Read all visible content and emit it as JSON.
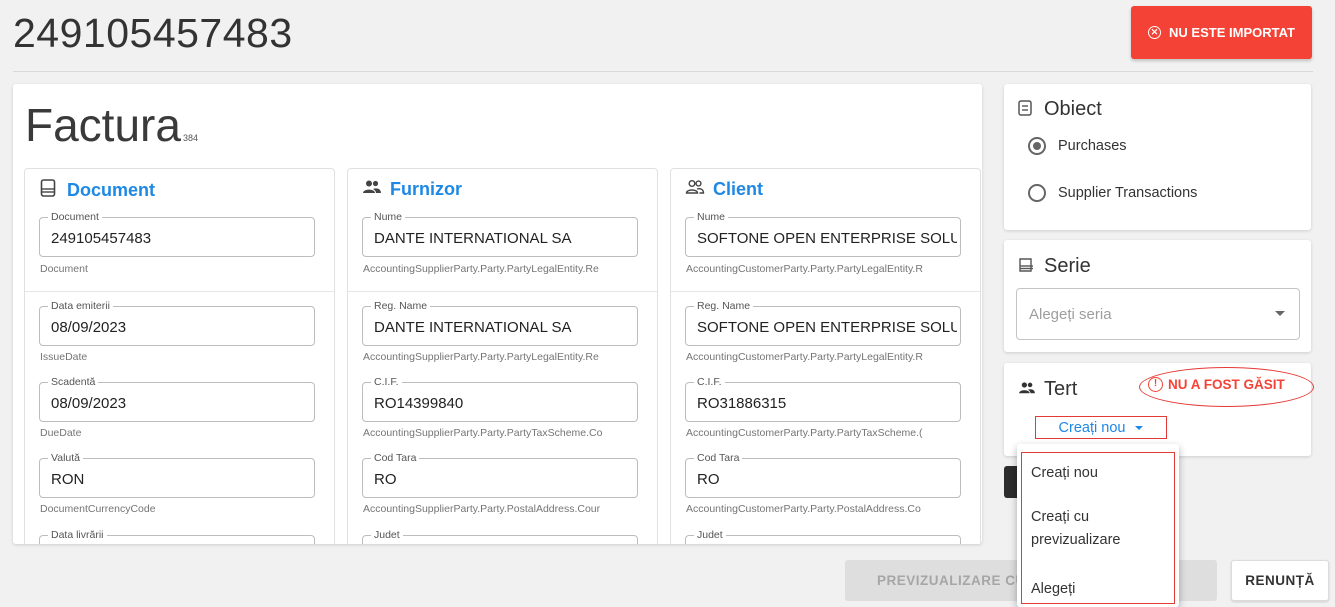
{
  "header": {
    "doc_number": "249105457483",
    "status_label": "NU ESTE IMPORTAT"
  },
  "invoice": {
    "title": "Factura",
    "count": "384"
  },
  "sections": [
    {
      "title": "Document",
      "icon": "document-icon",
      "fields": [
        {
          "label": "Document",
          "value": "249105457483",
          "hint": "Document"
        },
        {
          "label": "Data emiterii",
          "value": "08/09/2023",
          "hint": "IssueDate"
        },
        {
          "label": "Scadentă",
          "value": "08/09/2023",
          "hint": "DueDate"
        },
        {
          "label": "Valută",
          "value": "RON",
          "hint": "DocumentCurrencyCode"
        },
        {
          "label": "Data livrării",
          "value": "",
          "hint": ""
        }
      ]
    },
    {
      "title": "Furnizor",
      "icon": "people-icon",
      "fields": [
        {
          "label": "Nume",
          "value": "DANTE INTERNATIONAL SA",
          "hint": "AccountingSupplierParty.Party.PartyLegalEntity.Re"
        },
        {
          "label": "Reg. Name",
          "value": "DANTE INTERNATIONAL SA",
          "hint": "AccountingSupplierParty.Party.PartyLegalEntity.Re"
        },
        {
          "label": "C.I.F.",
          "value": "RO14399840",
          "hint": "AccountingSupplierParty.Party.PartyTaxScheme.Co"
        },
        {
          "label": "Cod Tara",
          "value": "RO",
          "hint": "AccountingSupplierParty.Party.PostalAddress.Cour"
        },
        {
          "label": "Judet",
          "value": "",
          "hint": ""
        }
      ]
    },
    {
      "title": "Client",
      "icon": "people-outline-icon",
      "fields": [
        {
          "label": "Nume",
          "value": "SOFTONE OPEN ENTERPRISE SOLUT",
          "hint": "AccountingCustomerParty.Party.PartyLegalEntity.R"
        },
        {
          "label": "Reg. Name",
          "value": "SOFTONE OPEN ENTERPRISE SOLUT",
          "hint": "AccountingCustomerParty.Party.PartyLegalEntity.R"
        },
        {
          "label": "C.I.F.",
          "value": "RO31886315",
          "hint": "AccountingCustomerParty.Party.PartyTaxScheme.("
        },
        {
          "label": "Cod Tara",
          "value": "RO",
          "hint": "AccountingCustomerParty.Party.PostalAddress.Co"
        },
        {
          "label": "Judet",
          "value": "",
          "hint": ""
        }
      ]
    }
  ],
  "obiect": {
    "title": "Obiect",
    "options": [
      "Purchases",
      "Supplier Transactions"
    ],
    "selected": "Purchases"
  },
  "serie": {
    "title": "Serie",
    "placeholder": "Alegeți seria"
  },
  "tert": {
    "title": "Tert",
    "warning": "NU A FOST GĂSIT",
    "dropdown_label": "Creați nou",
    "menu": [
      "Creați nou",
      "Creați cu previzualizare",
      "Alegeți"
    ]
  },
  "footer": {
    "preview_label": "PREVIZUALIZARE CU SALVARE",
    "cancel_label": "RENUNȚĂ"
  },
  "colors": {
    "accent": "#1e88e5",
    "danger": "#f44336"
  }
}
